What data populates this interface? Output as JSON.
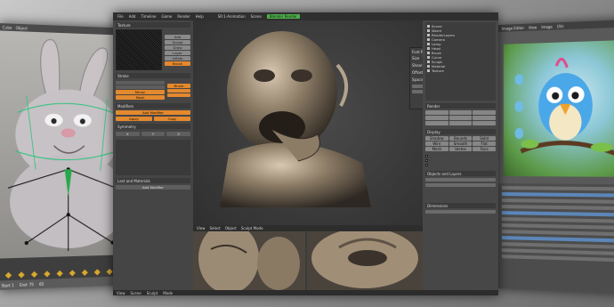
{
  "left_window": {
    "header_label": "Cube",
    "mode_label": "Object",
    "frame_start": "Start 1",
    "frame_end": "End: 75",
    "frame_current": "65"
  },
  "main_window": {
    "menu": [
      "File",
      "Add",
      "Timeline",
      "Game",
      "Render",
      "Help"
    ],
    "screen_label": "SR:1-Animation",
    "scene_label": "Scene",
    "render_status": "Blender Render",
    "tools_panel": {
      "texture_header": "Texture",
      "brush_button": "Brush",
      "stroke_header": "Stroke",
      "buttons": [
        "Add",
        "Sculpt",
        "Draw",
        "Layer",
        "Inflate"
      ],
      "orange_buttons": [
        "Mirror",
        "Mask",
        "Brush"
      ],
      "modifier_header": "Modifiers",
      "modifier_buttons": [
        "Add Modifier",
        "Apply",
        "Copy"
      ],
      "symmetry_header": "Symmetry",
      "symmetry_fields": [
        "X",
        "Y",
        "Z"
      ],
      "last_header": "Last and Materials",
      "last_field": "Add Modifier"
    },
    "floating_panel": {
      "title": "Font Properties",
      "rows": [
        "Size",
        "Shear",
        "Offset",
        "Spacing"
      ]
    },
    "viewport_footer": [
      "View",
      "Select",
      "Object",
      "Sculpt Mode"
    ],
    "outliner": {
      "title": "Scene",
      "items": [
        "World",
        "RenderLayers",
        "Camera",
        "Lamp",
        "Head",
        "Brush",
        "Curve",
        "Sculpt",
        "Material",
        "Texture"
      ]
    },
    "properties": {
      "tab": "Render",
      "section_display": "Display",
      "display_buttons": [
        "Shadow",
        "Bounds",
        "Solid",
        "Wire",
        "Smooth",
        "Flat",
        "Mesh",
        "Vertex",
        "Face"
      ],
      "section_objects": "Objects and Layers",
      "section_dimensions": "Dimensions"
    },
    "status_items": [
      "View",
      "Scene",
      "Sculpt",
      "Mode"
    ]
  },
  "right_window": {
    "title": "Image Editor",
    "menu": [
      "View",
      "Image",
      "UVs"
    ]
  }
}
